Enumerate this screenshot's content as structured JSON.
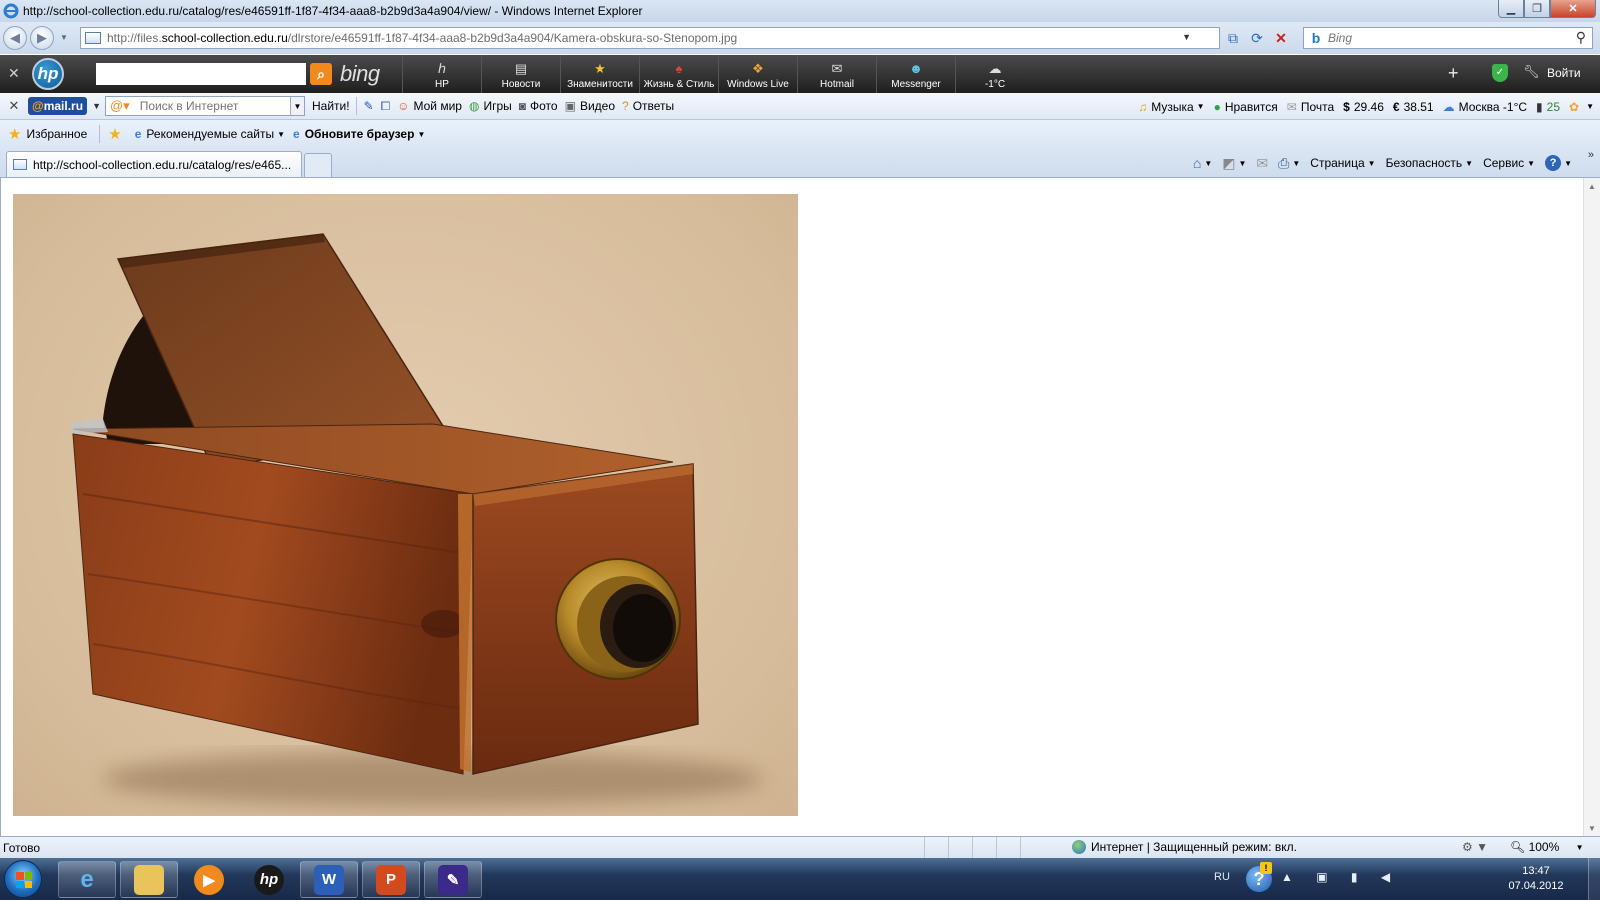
{
  "window": {
    "title": "http://school-collection.edu.ru/catalog/res/e46591ff-1f87-4f34-aaa8-b2b9d3a4a904/view/ - Windows Internet Explorer"
  },
  "address_bar": {
    "url_prefix": "http://files.",
    "url_domain": "school-collection.edu.ru",
    "url_path": "/dlrstore/e46591ff-1f87-4f34-aaa8-b2b9d3a4a904/Kamera-obskura-so-Stenopom.jpg"
  },
  "search": {
    "placeholder": "Bing"
  },
  "hp_toolbar": {
    "brand": "bing",
    "nav": [
      {
        "label": "HP",
        "icon": "hp-icon"
      },
      {
        "label": "Новости",
        "icon": "news-icon"
      },
      {
        "label": "Знаменитости",
        "icon": "star-icon"
      },
      {
        "label": "Жизнь & Стиль",
        "icon": "shoe-icon"
      },
      {
        "label": "Windows Live",
        "icon": "windows-icon"
      },
      {
        "label": "Hotmail",
        "icon": "mail-icon"
      },
      {
        "label": "Messenger",
        "icon": "messenger-icon"
      },
      {
        "label": "-1°C",
        "icon": "cloud-icon"
      }
    ],
    "login": "Войти"
  },
  "mail_toolbar": {
    "logo_at": "@",
    "logo_text": "mail.ru",
    "search_placeholder": "Поиск в Интернет",
    "find": "Найти!",
    "items": [
      "Мой мир",
      "Игры",
      "Фото",
      "Видео",
      "Ответы"
    ],
    "music": "Музыка",
    "like": "Нравится",
    "mail": "Почта",
    "usd_symbol": "$",
    "usd": "29.46",
    "eur_symbol": "€",
    "eur": "38.51",
    "weather": "Москва -1°C",
    "traffic": "25"
  },
  "favorites_bar": {
    "favorites": "Избранное",
    "recommended": "Рекомендуемые сайты",
    "update": "Обновите браузер"
  },
  "tabs": {
    "active_title": "http://school-collection.edu.ru/catalog/res/e465..."
  },
  "command_bar": {
    "page": "Страница",
    "safety": "Безопасность",
    "tools": "Сервис"
  },
  "status_bar": {
    "status": "Готово",
    "zone": "Интернет | Защищенный режим: вкл.",
    "zoom": "100%"
  },
  "taskbar": {
    "lang": "RU",
    "time": "13:47",
    "date": "07.04.2012"
  },
  "colors": {
    "photo_background": "#d8bf9f",
    "wood": "#7a3616",
    "brass": "#b98a2a"
  }
}
